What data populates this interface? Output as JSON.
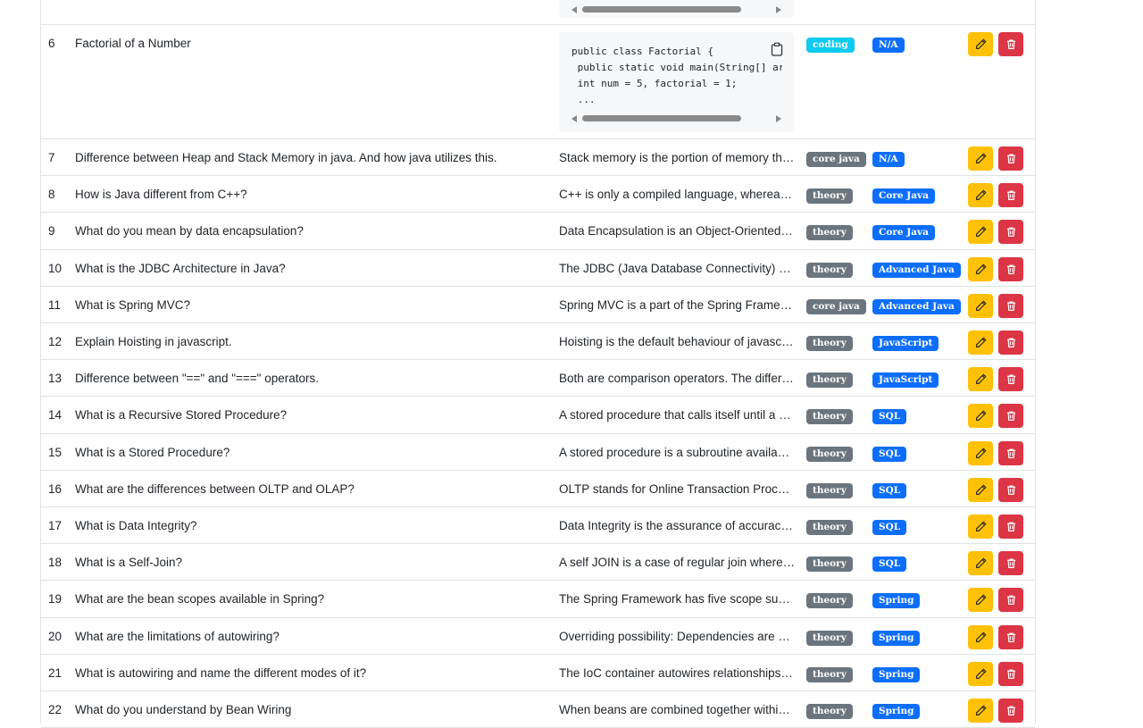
{
  "colors": {
    "coding": "#0dcaf0",
    "secondary": "#6c757d",
    "primary": "#0d6efd",
    "warning": "#ffc107",
    "danger": "#dc3545"
  },
  "icons": {
    "edit": "pencil-icon",
    "delete": "trash-icon",
    "copy": "clipboard-icon"
  },
  "code_row": {
    "num": "6",
    "question": "Factorial of a Number",
    "code_lines": [
      "public class Factorial {",
      " public static void main(String[] args) {",
      " int num = 5, factorial = 1;",
      " ..."
    ],
    "type": "coding",
    "category": "N/A"
  },
  "rows": [
    {
      "num": "7",
      "question": "Difference between Heap and Stack Memory in java. And how java utilizes this.",
      "answer": "Stack memory is the portion of memory that was assigned to every individual program.",
      "type": "core java",
      "category": "N/A"
    },
    {
      "num": "8",
      "question": "How is Java different from C++?",
      "answer": "C++ is only a compiled language, whereas Java is compiled as well as an interpreted language.",
      "type": "theory",
      "category": "Core Java"
    },
    {
      "num": "9",
      "question": "What do you mean by data encapsulation?",
      "answer": "Data Encapsulation is an Object-Oriented Programming concept.",
      "type": "theory",
      "category": "Core Java"
    },
    {
      "num": "10",
      "question": "What is the JDBC Architecture in Java?",
      "answer": "The JDBC (Java Database Connectivity) architecture.",
      "type": "theory",
      "category": "Advanced Java"
    },
    {
      "num": "11",
      "question": "What is Spring MVC?",
      "answer": "Spring MVC is a part of the Spring Framework.",
      "type": "core java",
      "category": "Advanced Java"
    },
    {
      "num": "12",
      "question": "Explain Hoisting in javascript.",
      "answer": "Hoisting is the default behaviour of javascript.",
      "type": "theory",
      "category": "JavaScript"
    },
    {
      "num": "13",
      "question": "Difference between \"==\" and \"===\" operators.",
      "answer": "Both are comparison operators. The difference between both.",
      "type": "theory",
      "category": "JavaScript"
    },
    {
      "num": "14",
      "question": "What is a Recursive Stored Procedure?",
      "answer": "A stored procedure that calls itself until a boundary condition is reached.",
      "type": "theory",
      "category": "SQL"
    },
    {
      "num": "15",
      "question": "What is a Stored Procedure?",
      "answer": "A stored procedure is a subroutine available to applications.",
      "type": "theory",
      "category": "SQL"
    },
    {
      "num": "16",
      "question": "What are the differences between OLTP and OLAP?",
      "answer": "OLTP stands for Online Transaction Processing.",
      "type": "theory",
      "category": "SQL"
    },
    {
      "num": "17",
      "question": "What is Data Integrity?",
      "answer": "Data Integrity is the assurance of accuracy and consistency.",
      "type": "theory",
      "category": "SQL"
    },
    {
      "num": "18",
      "question": "What is a Self-Join?",
      "answer": "A self JOIN is a case of regular join where a table is joined to itself.",
      "type": "theory",
      "category": "SQL"
    },
    {
      "num": "19",
      "question": "What are the bean scopes available in Spring?",
      "answer": "The Spring Framework has five scope supported.",
      "type": "theory",
      "category": "Spring"
    },
    {
      "num": "20",
      "question": "What are the limitations of autowiring?",
      "answer": "Overriding possibility: Dependencies are specified.",
      "type": "theory",
      "category": "Spring"
    },
    {
      "num": "21",
      "question": "What is autowiring and name the different modes of it?",
      "answer": "The IoC container autowires relationships between beans.",
      "type": "theory",
      "category": "Spring"
    },
    {
      "num": "22",
      "question": "What do you understand by Bean Wiring",
      "answer": "When beans are combined together within the Spring container.",
      "type": "theory",
      "category": "Spring"
    }
  ]
}
